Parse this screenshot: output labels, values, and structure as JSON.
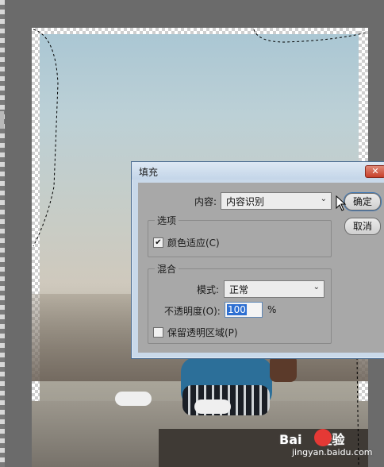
{
  "dialog": {
    "title": "填充",
    "content_label": "内容:",
    "content_value": "内容识别",
    "options_group": "选项",
    "color_adapt_label": "颜色适应(C)",
    "color_adapt_checked": true,
    "blend_group": "混合",
    "mode_label": "模式:",
    "mode_value": "正常",
    "opacity_label": "不透明度(O):",
    "opacity_value": "100",
    "opacity_unit": "%",
    "preserve_label": "保留透明区域(P)",
    "preserve_checked": false,
    "ok_label": "确定",
    "cancel_label": "取消"
  },
  "watermark": {
    "brand": "Bai",
    "brand2": "经验",
    "url": "jingyan.baidu.com"
  },
  "icons": [
    "close-icon",
    "dropdown-arrow-icon",
    "checkmark-icon",
    "mouse-cursor-icon"
  ]
}
